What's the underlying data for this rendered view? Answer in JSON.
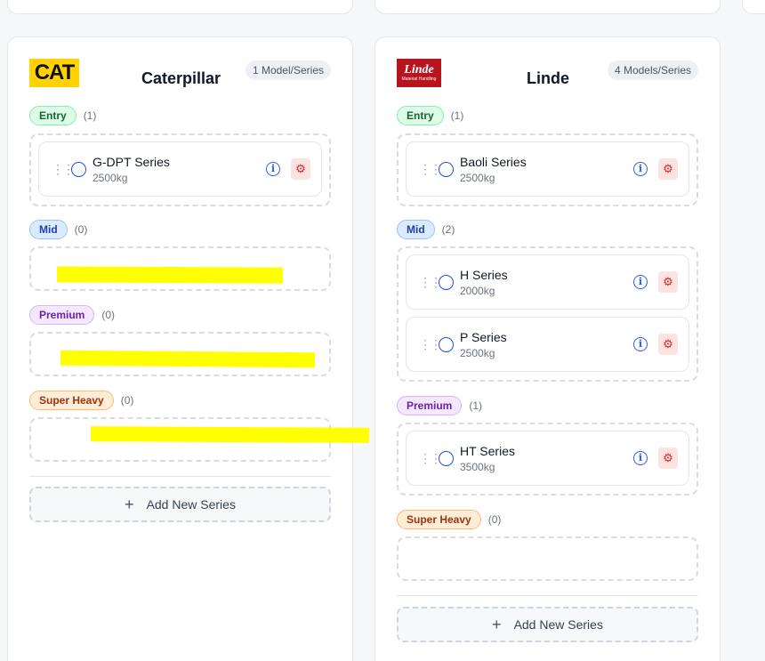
{
  "brands": [
    {
      "name": "Caterpillar",
      "logo_text": "CAT",
      "model_count": "1 Model/Series",
      "tiers": [
        {
          "label": "Entry",
          "count": "(1)",
          "series": [
            {
              "name": "G-DPT Series",
              "capacity": "2500kg"
            }
          ]
        },
        {
          "label": "Mid",
          "count": "(0)",
          "series": []
        },
        {
          "label": "Premium",
          "count": "(0)",
          "series": []
        },
        {
          "label": "Super Heavy",
          "count": "(0)",
          "series": []
        }
      ],
      "add_label": "Add New Series"
    },
    {
      "name": "Linde",
      "logo_text": "Linde",
      "logo_subtext": "Material Handling",
      "model_count": "4 Models/Series",
      "tiers": [
        {
          "label": "Entry",
          "count": "(1)",
          "series": [
            {
              "name": "Baoli Series",
              "capacity": "2500kg"
            }
          ]
        },
        {
          "label": "Mid",
          "count": "(2)",
          "series": [
            {
              "name": "H Series",
              "capacity": "2000kg"
            },
            {
              "name": "P Series",
              "capacity": "2500kg"
            }
          ]
        },
        {
          "label": "Premium",
          "count": "(1)",
          "series": [
            {
              "name": "HT Series",
              "capacity": "3500kg"
            }
          ]
        },
        {
          "label": "Super Heavy",
          "count": "(0)",
          "series": []
        }
      ],
      "add_label": "Add New Series"
    }
  ],
  "icons": {
    "grip": "drag-handle-icon",
    "info": "info-icon",
    "settings": "gear-icon",
    "add": "plus-icon"
  },
  "colors": {
    "highlight": "#ffff00",
    "entry": "#dcfce7",
    "mid": "#dbeafe",
    "premium": "#f3e8ff",
    "super_heavy": "#ffedd5"
  }
}
